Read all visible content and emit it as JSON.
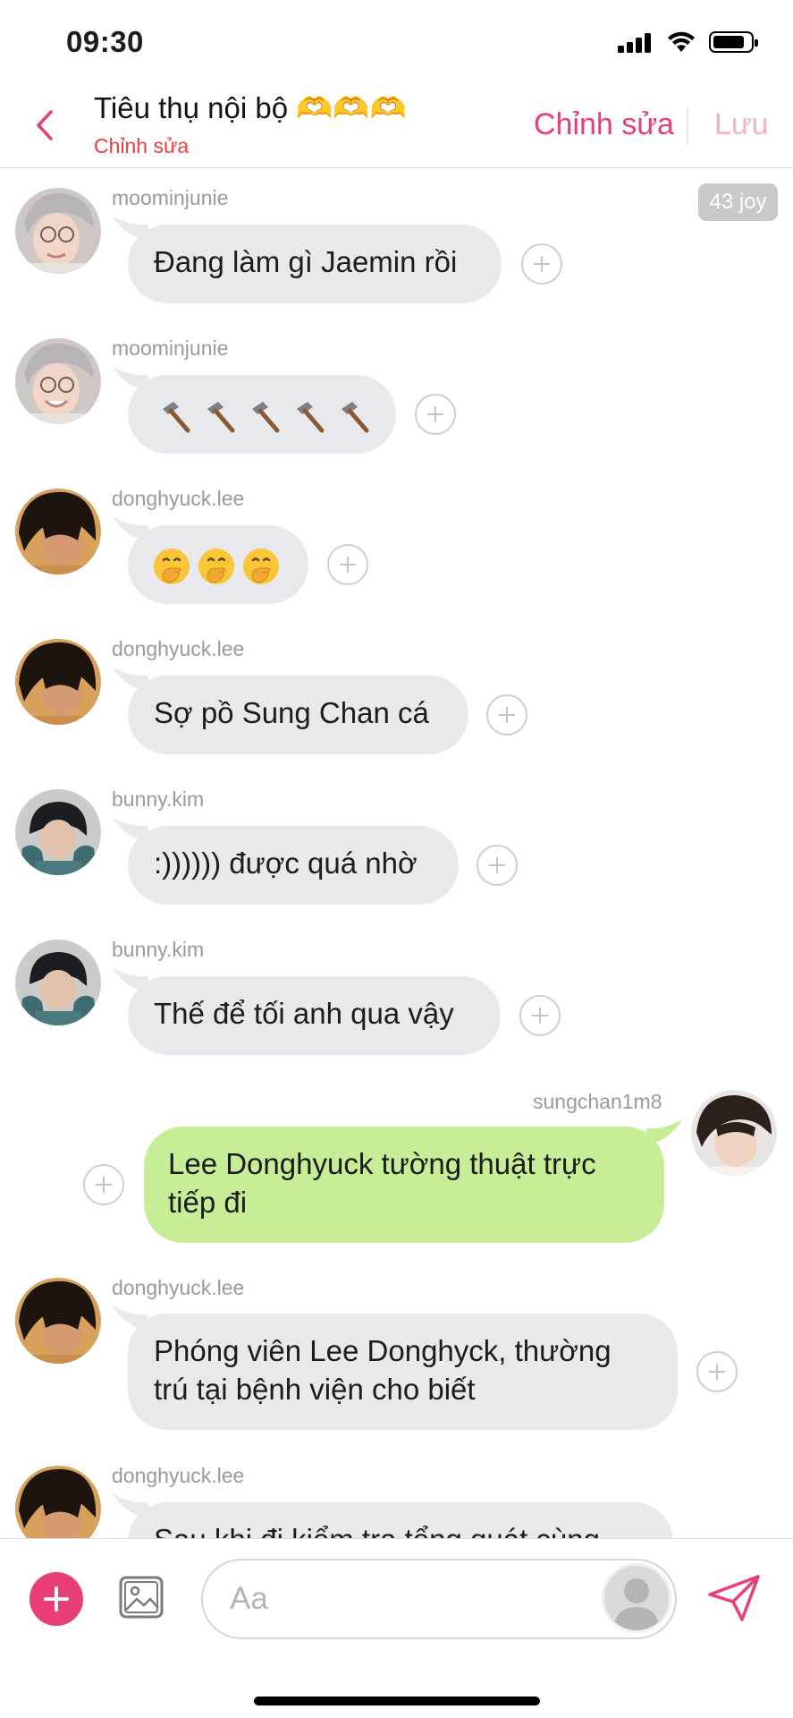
{
  "status_bar": {
    "time": "09:30"
  },
  "header": {
    "title": "Tiêu thụ nội bộ 🫶🫶🫶",
    "subtitle": "Chỉnh sửa",
    "edit_label": "Chỉnh sửa",
    "save_label": "Lưu"
  },
  "joy_badge": "43 joy",
  "messages": [
    {
      "user": "moominjunie",
      "text": "Đang làm gì Jaemin rồi",
      "direction": "in"
    },
    {
      "user": "moominjunie",
      "emoji": [
        "hammer-icon",
        "hammer-icon",
        "hammer-icon",
        "hammer-icon",
        "hammer-icon"
      ],
      "direction": "in"
    },
    {
      "user": "donghyuck.lee",
      "emoji": [
        "hand-over-mouth-emoji",
        "hand-over-mouth-emoji",
        "hand-over-mouth-emoji"
      ],
      "direction": "in"
    },
    {
      "user": "donghyuck.lee",
      "text": "Sợ pồ Sung Chan cá",
      "direction": "in"
    },
    {
      "user": "bunny.kim",
      "text": ":)))))) được quá nhờ",
      "direction": "in"
    },
    {
      "user": "bunny.kim",
      "text": "Thế để tối anh qua vậy",
      "direction": "in"
    },
    {
      "user": "sungchan1m8",
      "lines": [
        "Lee Donghyuck tường thuật trực",
        "tiếp đi"
      ],
      "direction": "out"
    },
    {
      "user": "donghyuck.lee",
      "lines": [
        "Phóng viên Lee Donghyck, thường",
        "trú tại bệnh viện cho biết"
      ],
      "direction": "in"
    },
    {
      "user": "donghyuck.lee",
      "text": "Sau khi đi kiểm tra tổng quát cùng",
      "direction": "in"
    }
  ],
  "composer": {
    "placeholder": "Aa"
  },
  "colors": {
    "accent": "#ea3e79",
    "incoming_bubble": "#e8e9ec",
    "outgoing_bubble": "#c7ed96",
    "subtitle_red": "#ef3b3b"
  }
}
